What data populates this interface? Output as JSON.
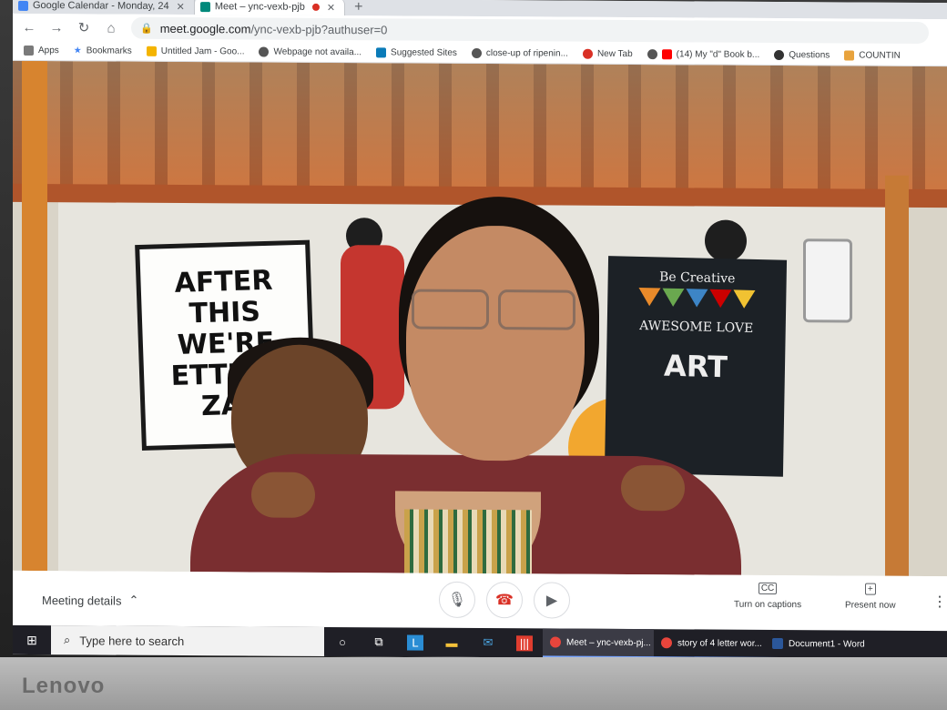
{
  "tabs": [
    {
      "title": "Google Calendar - Monday, 24",
      "active": false
    },
    {
      "title": "Meet – ync-vexb-pjb",
      "active": true,
      "recording": true
    }
  ],
  "address": {
    "host": "meet.google.com",
    "path": "/ync-vexb-pjb?authuser=0"
  },
  "bookmarks": [
    {
      "label": "Apps",
      "icon": "apps-grid-icon"
    },
    {
      "label": "Bookmarks",
      "icon": "star-icon"
    },
    {
      "label": "Untitled Jam - Goo...",
      "icon": "jamboard-icon"
    },
    {
      "label": "Webpage not availa...",
      "icon": "globe-icon"
    },
    {
      "label": "Suggested Sites",
      "icon": "bing-icon"
    },
    {
      "label": "close-up of ripenin...",
      "icon": "globe-icon"
    },
    {
      "label": "New Tab",
      "icon": "new-tab-icon"
    },
    {
      "label": "(14) My \"d\" Book b...",
      "icon": "youtube-icon"
    },
    {
      "label": "Questions",
      "icon": "questions-icon"
    },
    {
      "label": "COUNTIN",
      "icon": "bookmark-icon"
    }
  ],
  "video": {
    "poster_text": [
      "AFTER",
      "THIS",
      "WE'RE",
      "ETTING",
      "ZA!"
    ],
    "chalkboard": {
      "top": "Be Creative",
      "middle": "AWESOME",
      "love": "LOVE",
      "big": "ART"
    }
  },
  "meet": {
    "meeting_details": "Meeting details",
    "captions_label": "Turn on captions",
    "captions_icon_text": "CC",
    "present_label": "Present now"
  },
  "taskbar": {
    "search_placeholder": "Type here to search",
    "apps": [
      {
        "label": "Meet – ync-vexb-pj...",
        "color": "#e8453c",
        "active": true
      },
      {
        "label": "story of 4 letter wor...",
        "color": "#e8453c",
        "active": false
      },
      {
        "label": "Document1 - Word",
        "color": "#2b579a",
        "active": false
      }
    ]
  },
  "brand": "Lenovo"
}
